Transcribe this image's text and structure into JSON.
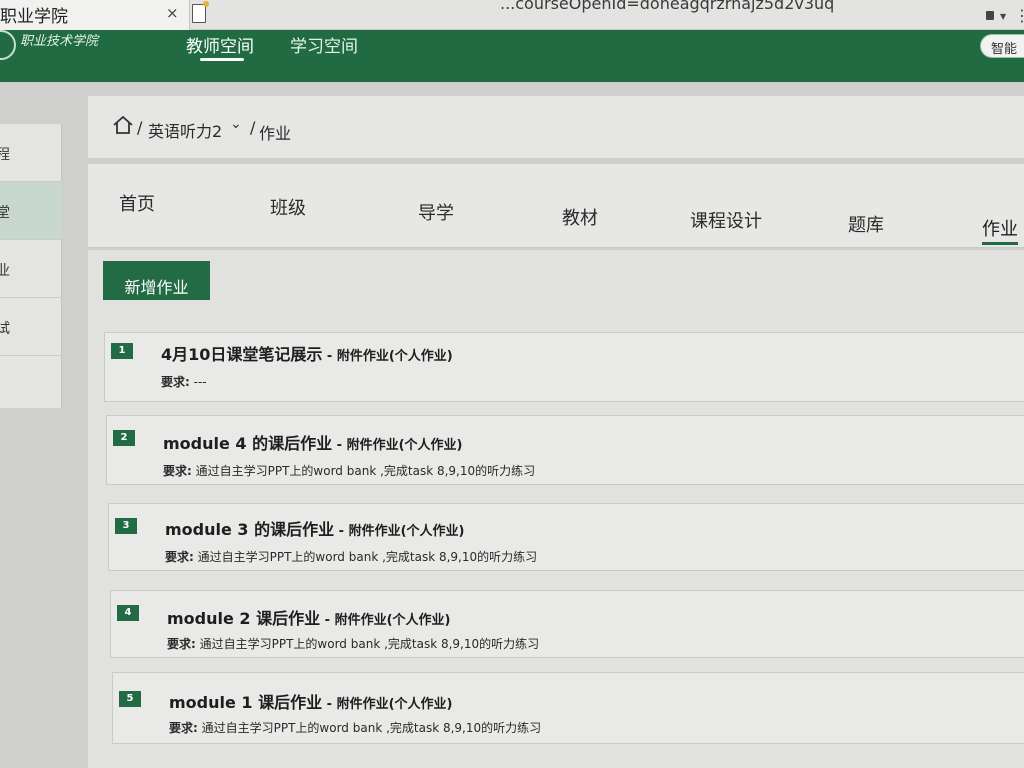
{
  "browser": {
    "tab_title": "职业学院",
    "tab_close": "×",
    "url": "...courseOpenId=doheagqrzrnajz5d2v3uq"
  },
  "header": {
    "logo_line1": "职业技术学院",
    "logo_line2": "",
    "nav": [
      {
        "label": "教师空间",
        "active": true
      },
      {
        "label": "学习空间",
        "active": false
      }
    ],
    "smart_badge": "智能"
  },
  "sidebar": {
    "items": [
      {
        "label": "程",
        "active": true
      },
      {
        "label": "堂",
        "active": false
      },
      {
        "label": "业",
        "active": false
      },
      {
        "label": "试",
        "active": false
      }
    ]
  },
  "breadcrumb": {
    "sep": "/",
    "course": "英语听力2",
    "chevron": "⌄",
    "current": "作业"
  },
  "course_tabs": [
    {
      "label": "首页"
    },
    {
      "label": "班级"
    },
    {
      "label": "导学"
    },
    {
      "label": "教材"
    },
    {
      "label": "课程设计"
    },
    {
      "label": "题库"
    },
    {
      "label": "作业",
      "active": true
    }
  ],
  "add_button": "新增作业",
  "homework": [
    {
      "num": "1",
      "title": "4月10日课堂笔记展示",
      "type": " - 附件作业(个人作业)",
      "req_label": "要求:",
      "req": " ---"
    },
    {
      "num": "2",
      "title": "module 4 的课后作业",
      "type": " - 附件作业(个人作业)",
      "req_label": "要求:",
      "req": " 通过自主学习PPT上的word bank ,完成task 8,9,10的听力练习"
    },
    {
      "num": "3",
      "title": "module 3 的课后作业",
      "type": " - 附件作业(个人作业)",
      "req_label": "要求:",
      "req": " 通过自主学习PPT上的word bank ,完成task 8,9,10的听力练习"
    },
    {
      "num": "4",
      "title": "module 2 课后作业",
      "type": " - 附件作业(个人作业)",
      "req_label": "要求:",
      "req": " 通过自主学习PPT上的word bank ,完成task 8,9,10的听力练习"
    },
    {
      "num": "5",
      "title": "module 1 课后作业",
      "type": " - 附件作业(个人作业)",
      "req_label": "要求:",
      "req": " 通过自主学习PPT上的word bank ,完成task 8,9,10的听力练习"
    }
  ]
}
